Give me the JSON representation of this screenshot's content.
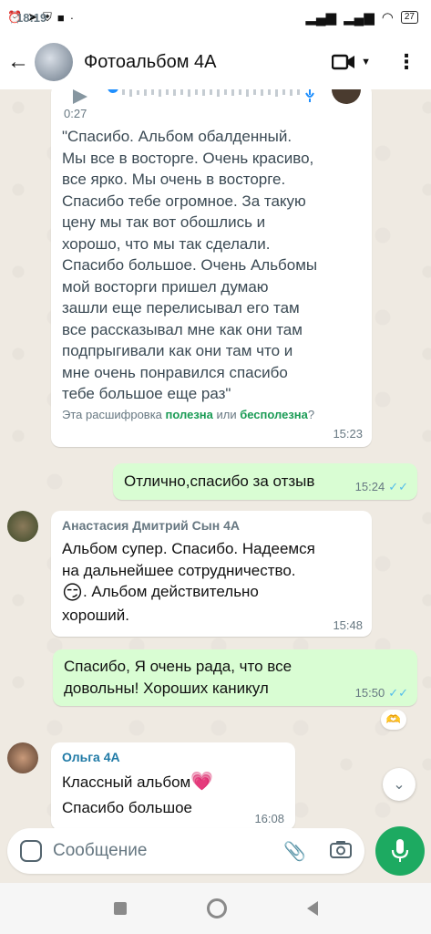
{
  "status_bar": {
    "time": "18:19",
    "battery": "27"
  },
  "header": {
    "title": "Фотоальбом 4А"
  },
  "messages": {
    "voice": {
      "duration": "0:27",
      "transcript": "\"Спасибо. Альбом обалденный.\nМы все в восторге. Очень красиво,\nвсе ярко. Мы очень в восторге.\nСпасибо тебе огромное. За такую\nцену мы так вот обошлись и\nхорошо, что мы так сделали.\nСпасибо большое. Очень Альбомы\nмой восторги пришел думаю\nзашли еще перелисывал его там\nвсе рассказывал мне как они там\nподпрыгивали как они там что и\nмне очень понравился спасибо\nтебе большое еще раз\"",
      "feedback_prefix": "Эта расшифровка ",
      "feedback_useful": "полезна",
      "feedback_mid": " или ",
      "feedback_useless": "бесполезна",
      "feedback_suffix": "?",
      "time": "15:23"
    },
    "out1": {
      "text": "Отлично,спасибо за отзыв",
      "time": "15:24"
    },
    "in1": {
      "sender": "Анастасия Дмитрий Сын 4А",
      "text": "Альбом супер. Спасибо. Надеемся\nна дальнейшее сотрудничество.",
      "emoji": "😏",
      "text2": ". Альбом действительно\nхороший.",
      "time": "15:48"
    },
    "out2": {
      "text": "Спасибо, Я очень рада, что все\nдовольны! Хороших каникул",
      "time": "15:50",
      "reaction": "🫶"
    },
    "in2": {
      "sender": "Ольга 4А",
      "text": "Классный альбом",
      "emoji": "💗",
      "text2": "Спасибо большое",
      "time": "16:08"
    }
  },
  "input": {
    "placeholder": "Сообщение"
  },
  "colors": {
    "accent": "#1daa61",
    "outgoing": "#d9fdd3",
    "sender1": "#667781",
    "sender2": "#1f7aa6"
  }
}
